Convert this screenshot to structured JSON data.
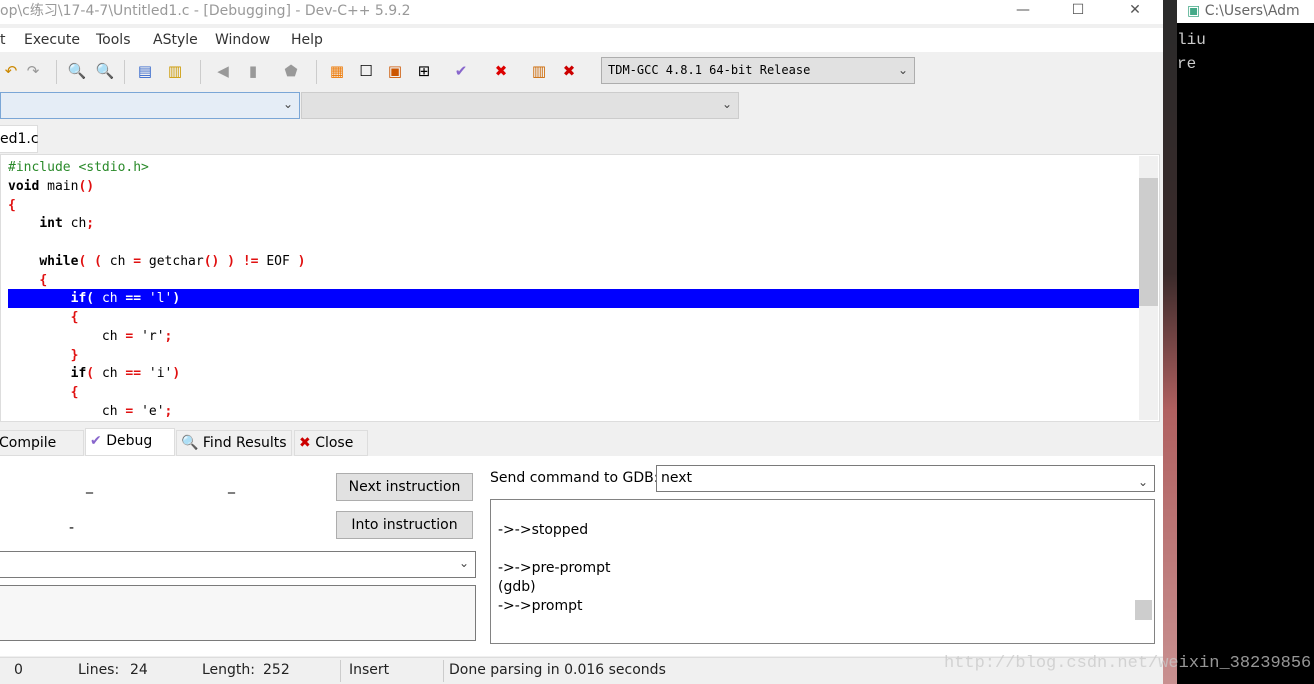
{
  "title_bar": {
    "title": "op\\c练习\\17-4-7\\Untitled1.c - [Debugging] - Dev-C++ 5.9.2",
    "minimize": "—",
    "maximize": "☐",
    "close": "✕"
  },
  "menu": [
    "t",
    "Execute",
    "Tools",
    "AStyle",
    "Window",
    "Help"
  ],
  "toolbar": {
    "icons": [
      "undo-icon",
      "redo-icon",
      "find-icon",
      "replace-icon",
      "indent-icon",
      "unindent-icon",
      "bookmark-prev-icon",
      "bookmark-next-icon",
      "bookmark-icon",
      "new-project-icon",
      "window-icon",
      "color-icon",
      "grid-icon",
      "check-icon",
      "delete-icon",
      "chart-icon",
      "profile-delete-icon"
    ],
    "compiler": "TDM-GCC 4.8.1 64-bit Release"
  },
  "editor": {
    "tab": "ed1.c",
    "highlight_color": "#0000ff",
    "lines": [
      [
        [
          "p",
          "#include <stdio.h>"
        ]
      ],
      [
        [
          "k",
          "void"
        ],
        [
          "n",
          " main"
        ],
        [
          "s",
          "()"
        ]
      ],
      [
        [
          "s",
          "{"
        ]
      ],
      [
        [
          "n",
          "    "
        ],
        [
          "k",
          "int"
        ],
        [
          "n",
          " ch"
        ],
        [
          "s",
          ";"
        ]
      ],
      [
        [
          "n",
          ""
        ]
      ],
      [
        [
          "n",
          "    "
        ],
        [
          "k",
          "while"
        ],
        [
          "s",
          "( ( "
        ],
        [
          "n",
          "ch "
        ],
        [
          "s",
          "= "
        ],
        [
          "n",
          "getchar"
        ],
        [
          "s",
          "() ) != "
        ],
        [
          "n",
          "EOF "
        ],
        [
          "s",
          ")"
        ]
      ],
      [
        [
          "n",
          "    "
        ],
        [
          "s",
          "{"
        ]
      ],
      [
        [
          "n",
          "        "
        ],
        [
          "k",
          "if"
        ],
        [
          "s",
          "( "
        ],
        [
          "n",
          "ch "
        ],
        [
          "s",
          "== "
        ],
        [
          "q",
          "'l'"
        ],
        [
          "s",
          ")"
        ]
      ],
      [
        [
          "n",
          "        "
        ],
        [
          "s",
          "{"
        ]
      ],
      [
        [
          "n",
          "            ch "
        ],
        [
          "s",
          "= "
        ],
        [
          "q",
          "'r'"
        ],
        [
          "s",
          ";"
        ]
      ],
      [
        [
          "n",
          "        "
        ],
        [
          "s",
          "}"
        ]
      ],
      [
        [
          "n",
          "        "
        ],
        [
          "k",
          "if"
        ],
        [
          "s",
          "( "
        ],
        [
          "n",
          "ch "
        ],
        [
          "s",
          "== "
        ],
        [
          "q",
          "'i'"
        ],
        [
          "s",
          ")"
        ]
      ],
      [
        [
          "n",
          "        "
        ],
        [
          "s",
          "{"
        ]
      ],
      [
        [
          "n",
          "            ch "
        ],
        [
          "s",
          "= "
        ],
        [
          "q",
          "'e'"
        ],
        [
          "s",
          ";"
        ]
      ]
    ],
    "highlight_line": 7
  },
  "bottom_tabs": [
    "Compile Log",
    "Debug",
    "Find Results",
    "Close"
  ],
  "debug": {
    "next_instruction": "Next instruction",
    "into_instruction": "Into instruction",
    "dash1": "_",
    "dash2": "_",
    "dash3": "-",
    "gdb_label": "Send command to GDB:",
    "gdb_command": "next",
    "output": [
      "->->stopped",
      "",
      "->->pre-prompt",
      "(gdb)",
      "->->prompt"
    ]
  },
  "status": {
    "col": "0",
    "lines_label": "Lines:",
    "lines": "24",
    "length_label": "Length:",
    "length": "252",
    "mode": "Insert",
    "message": "Done parsing in 0.016 seconds"
  },
  "console": {
    "title": "C:\\Users\\Adm",
    "output": [
      "liu",
      "re"
    ]
  },
  "watermark": "http://blog.csdn.net/weixin_38239856"
}
